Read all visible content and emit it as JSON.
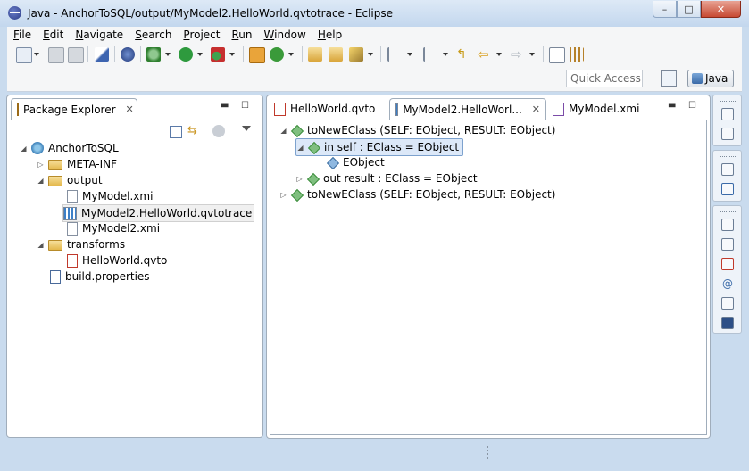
{
  "window": {
    "title": "Java - AnchorToSQL/output/MyModel2.HelloWorld.qvtotrace - Eclipse",
    "minimize": "–",
    "maximize": "□",
    "close": "✕"
  },
  "menu": {
    "items": [
      {
        "mnemonic": "F",
        "rest": "ile"
      },
      {
        "mnemonic": "E",
        "rest": "dit"
      },
      {
        "mnemonic": "N",
        "rest": "avigate"
      },
      {
        "mnemonic": "S",
        "rest": "earch"
      },
      {
        "mnemonic": "P",
        "rest": "roject"
      },
      {
        "mnemonic": "R",
        "rest": "un"
      },
      {
        "mnemonic": "W",
        "rest": "indow"
      },
      {
        "mnemonic": "H",
        "rest": "elp"
      }
    ]
  },
  "toolbar": {
    "quick_access_placeholder": "Quick Access",
    "perspective_label": "Java"
  },
  "package_explorer": {
    "tab_label": "Package Explorer",
    "tree": [
      {
        "label": "AnchorToSQL",
        "icon": "project-icon"
      },
      {
        "label": "META-INF",
        "icon": "folder-icon"
      },
      {
        "label": "output",
        "icon": "folder-icon"
      },
      {
        "label": "MyModel.xmi",
        "icon": "xmi-file-icon"
      },
      {
        "label": "MyModel2.HelloWorld.qvtotrace",
        "icon": "trace-file-icon"
      },
      {
        "label": "MyModel2.xmi",
        "icon": "xmi-file-icon"
      },
      {
        "label": "transforms",
        "icon": "folder-icon"
      },
      {
        "label": "HelloWorld.qvto",
        "icon": "qvto-file-icon"
      },
      {
        "label": "build.properties",
        "icon": "properties-file-icon"
      }
    ]
  },
  "editor": {
    "tabs": [
      {
        "label": "HelloWorld.qvto"
      },
      {
        "label": "MyModel2.HelloWorl..."
      },
      {
        "label": "MyModel.xmi"
      }
    ],
    "tree": [
      {
        "label": "toNewEClass (SELF: EObject, RESULT: EObject)"
      },
      {
        "label": "in self : EClass = EObject"
      },
      {
        "label": "EObject"
      },
      {
        "label": "out result : EClass = EObject"
      },
      {
        "label": "toNewEClass (SELF: EObject, RESULT: EObject)"
      }
    ]
  },
  "colors": {
    "accent": "#3b7fb8",
    "selection": "#dce8f8",
    "window_bg": "#c9dbee"
  }
}
